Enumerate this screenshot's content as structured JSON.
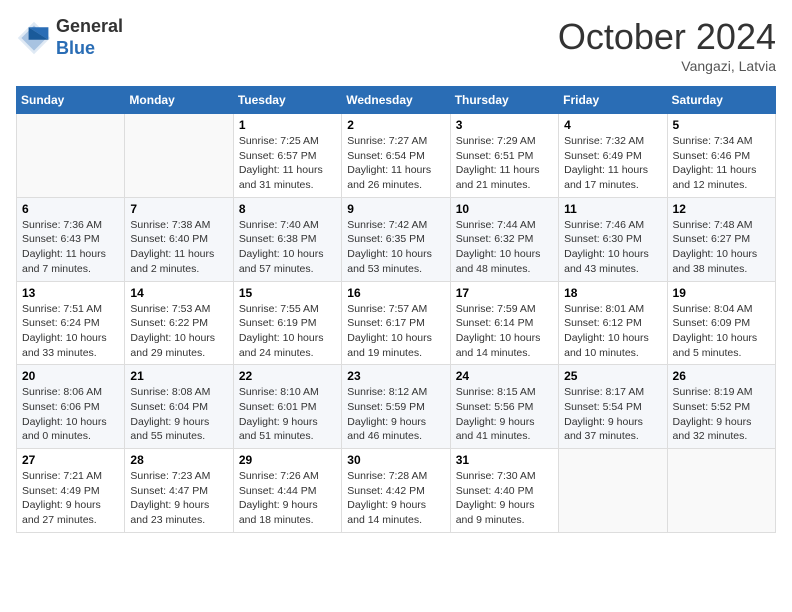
{
  "header": {
    "logo_line1": "General",
    "logo_line2": "Blue",
    "month_title": "October 2024",
    "location": "Vangazi, Latvia"
  },
  "weekdays": [
    "Sunday",
    "Monday",
    "Tuesday",
    "Wednesday",
    "Thursday",
    "Friday",
    "Saturday"
  ],
  "weeks": [
    [
      {
        "day": "",
        "info": ""
      },
      {
        "day": "",
        "info": ""
      },
      {
        "day": "1",
        "info": "Sunrise: 7:25 AM\nSunset: 6:57 PM\nDaylight: 11 hours\nand 31 minutes."
      },
      {
        "day": "2",
        "info": "Sunrise: 7:27 AM\nSunset: 6:54 PM\nDaylight: 11 hours\nand 26 minutes."
      },
      {
        "day": "3",
        "info": "Sunrise: 7:29 AM\nSunset: 6:51 PM\nDaylight: 11 hours\nand 21 minutes."
      },
      {
        "day": "4",
        "info": "Sunrise: 7:32 AM\nSunset: 6:49 PM\nDaylight: 11 hours\nand 17 minutes."
      },
      {
        "day": "5",
        "info": "Sunrise: 7:34 AM\nSunset: 6:46 PM\nDaylight: 11 hours\nand 12 minutes."
      }
    ],
    [
      {
        "day": "6",
        "info": "Sunrise: 7:36 AM\nSunset: 6:43 PM\nDaylight: 11 hours\nand 7 minutes."
      },
      {
        "day": "7",
        "info": "Sunrise: 7:38 AM\nSunset: 6:40 PM\nDaylight: 11 hours\nand 2 minutes."
      },
      {
        "day": "8",
        "info": "Sunrise: 7:40 AM\nSunset: 6:38 PM\nDaylight: 10 hours\nand 57 minutes."
      },
      {
        "day": "9",
        "info": "Sunrise: 7:42 AM\nSunset: 6:35 PM\nDaylight: 10 hours\nand 53 minutes."
      },
      {
        "day": "10",
        "info": "Sunrise: 7:44 AM\nSunset: 6:32 PM\nDaylight: 10 hours\nand 48 minutes."
      },
      {
        "day": "11",
        "info": "Sunrise: 7:46 AM\nSunset: 6:30 PM\nDaylight: 10 hours\nand 43 minutes."
      },
      {
        "day": "12",
        "info": "Sunrise: 7:48 AM\nSunset: 6:27 PM\nDaylight: 10 hours\nand 38 minutes."
      }
    ],
    [
      {
        "day": "13",
        "info": "Sunrise: 7:51 AM\nSunset: 6:24 PM\nDaylight: 10 hours\nand 33 minutes."
      },
      {
        "day": "14",
        "info": "Sunrise: 7:53 AM\nSunset: 6:22 PM\nDaylight: 10 hours\nand 29 minutes."
      },
      {
        "day": "15",
        "info": "Sunrise: 7:55 AM\nSunset: 6:19 PM\nDaylight: 10 hours\nand 24 minutes."
      },
      {
        "day": "16",
        "info": "Sunrise: 7:57 AM\nSunset: 6:17 PM\nDaylight: 10 hours\nand 19 minutes."
      },
      {
        "day": "17",
        "info": "Sunrise: 7:59 AM\nSunset: 6:14 PM\nDaylight: 10 hours\nand 14 minutes."
      },
      {
        "day": "18",
        "info": "Sunrise: 8:01 AM\nSunset: 6:12 PM\nDaylight: 10 hours\nand 10 minutes."
      },
      {
        "day": "19",
        "info": "Sunrise: 8:04 AM\nSunset: 6:09 PM\nDaylight: 10 hours\nand 5 minutes."
      }
    ],
    [
      {
        "day": "20",
        "info": "Sunrise: 8:06 AM\nSunset: 6:06 PM\nDaylight: 10 hours\nand 0 minutes."
      },
      {
        "day": "21",
        "info": "Sunrise: 8:08 AM\nSunset: 6:04 PM\nDaylight: 9 hours\nand 55 minutes."
      },
      {
        "day": "22",
        "info": "Sunrise: 8:10 AM\nSunset: 6:01 PM\nDaylight: 9 hours\nand 51 minutes."
      },
      {
        "day": "23",
        "info": "Sunrise: 8:12 AM\nSunset: 5:59 PM\nDaylight: 9 hours\nand 46 minutes."
      },
      {
        "day": "24",
        "info": "Sunrise: 8:15 AM\nSunset: 5:56 PM\nDaylight: 9 hours\nand 41 minutes."
      },
      {
        "day": "25",
        "info": "Sunrise: 8:17 AM\nSunset: 5:54 PM\nDaylight: 9 hours\nand 37 minutes."
      },
      {
        "day": "26",
        "info": "Sunrise: 8:19 AM\nSunset: 5:52 PM\nDaylight: 9 hours\nand 32 minutes."
      }
    ],
    [
      {
        "day": "27",
        "info": "Sunrise: 7:21 AM\nSunset: 4:49 PM\nDaylight: 9 hours\nand 27 minutes."
      },
      {
        "day": "28",
        "info": "Sunrise: 7:23 AM\nSunset: 4:47 PM\nDaylight: 9 hours\nand 23 minutes."
      },
      {
        "day": "29",
        "info": "Sunrise: 7:26 AM\nSunset: 4:44 PM\nDaylight: 9 hours\nand 18 minutes."
      },
      {
        "day": "30",
        "info": "Sunrise: 7:28 AM\nSunset: 4:42 PM\nDaylight: 9 hours\nand 14 minutes."
      },
      {
        "day": "31",
        "info": "Sunrise: 7:30 AM\nSunset: 4:40 PM\nDaylight: 9 hours\nand 9 minutes."
      },
      {
        "day": "",
        "info": ""
      },
      {
        "day": "",
        "info": ""
      }
    ]
  ]
}
